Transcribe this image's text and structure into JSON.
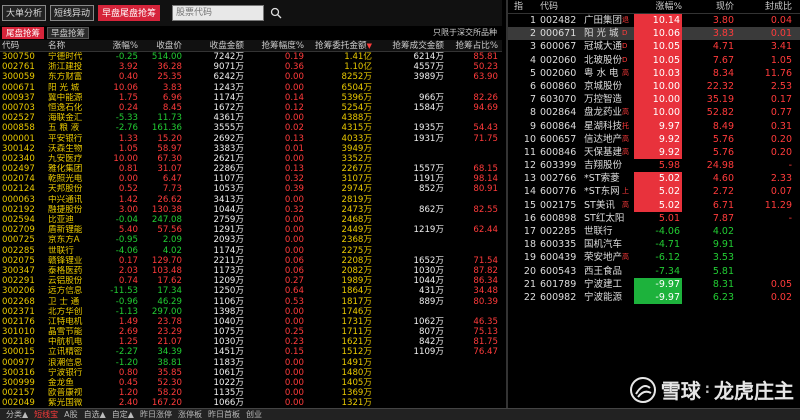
{
  "topbar": {
    "buttons": [
      "大单分析",
      "短线异动",
      "早盘尾盘抢筹"
    ],
    "search_placeholder": "股票代码"
  },
  "subtabs": [
    "尾盘抢筹",
    "早盘抢筹"
  ],
  "only_note": "只限于深交所品种",
  "left_headers": [
    "代码",
    "名称",
    "涨幅%",
    "收盘价",
    "收盘金额",
    "抢筹幅度%",
    "抢筹委托金额",
    "抢筹成交金额",
    "抢筹占比%"
  ],
  "left_rows": [
    [
      "300750",
      "宁德时代",
      "-0.25",
      "514.00",
      "7242万",
      "0.19",
      "1.41亿",
      "6214万",
      "85.81"
    ],
    [
      "002761",
      "浙江建投",
      "3.92",
      "36.28",
      "9071万",
      "0.36",
      "1.10亿",
      "4557万",
      "50.23"
    ],
    [
      "300059",
      "东方财富",
      "0.40",
      "25.35",
      "6242万",
      "0.00",
      "8252万",
      "3989万",
      "63.90"
    ],
    [
      "000671",
      "阳 光 城",
      "10.06",
      "3.83",
      "1243万",
      "0.00",
      "6504万",
      "",
      ""
    ],
    [
      "000937",
      "冀中能源",
      "1.75",
      "6.96",
      "1174万",
      "0.14",
      "5396万",
      "966万",
      "82.26"
    ],
    [
      "000703",
      "恒逸石化",
      "0.24",
      "8.45",
      "1672万",
      "0.12",
      "5254万",
      "1584万",
      "94.69"
    ],
    [
      "002527",
      "海联金汇",
      "-5.33",
      "11.73",
      "4361万",
      "0.00",
      "4388万",
      "",
      ""
    ],
    [
      "000858",
      "五 粮 液",
      "-2.76",
      "161.36",
      "3555万",
      "0.02",
      "4315万",
      "1935万",
      "54.43"
    ],
    [
      "000001",
      "平安银行",
      "1.33",
      "15.20",
      "2692万",
      "0.13",
      "4033万",
      "1931万",
      "71.75"
    ],
    [
      "300142",
      "沃森生物",
      "1.05",
      "58.97",
      "3383万",
      "0.01",
      "3949万",
      "",
      ""
    ],
    [
      "002340",
      "九安医疗",
      "10.00",
      "67.30",
      "2621万",
      "0.00",
      "3352万",
      "",
      ""
    ],
    [
      "002497",
      "雅化集团",
      "0.81",
      "31.07",
      "2286万",
      "0.13",
      "2267万",
      "1557万",
      "68.15"
    ],
    [
      "002074",
      "乾照光电",
      "0.00",
      "6.47",
      "1107万",
      "0.32",
      "3107万",
      "1191万",
      "98.14"
    ],
    [
      "002124",
      "天邦股份",
      "0.52",
      "7.73",
      "1053万",
      "0.39",
      "2974万",
      "852万",
      "80.91"
    ],
    [
      "000063",
      "中兴通讯",
      "1.42",
      "26.62",
      "3413万",
      "0.00",
      "2819万",
      "",
      ""
    ],
    [
      "002192",
      "融捷股份",
      "3.00",
      "130.38",
      "1044万",
      "0.32",
      "2473万",
      "862万",
      "82.55"
    ],
    [
      "002594",
      "比亚迪",
      "-0.04",
      "247.08",
      "2759万",
      "0.00",
      "2468万",
      "",
      ""
    ],
    [
      "002709",
      "盾新锂能",
      "5.40",
      "57.56",
      "1291万",
      "0.00",
      "2449万",
      "1219万",
      "62.44"
    ],
    [
      "000725",
      "京东方A",
      "-0.95",
      "2.09",
      "2093万",
      "0.00",
      "2368万",
      "",
      ""
    ],
    [
      "002285",
      "世联行",
      "-4.06",
      "4.02",
      "1174万",
      "0.00",
      "2275万",
      "",
      ""
    ],
    [
      "002075",
      "赣锋锂业",
      "0.17",
      "129.70",
      "2211万",
      "0.06",
      "2208万",
      "1652万",
      "71.54"
    ],
    [
      "300347",
      "泰格医药",
      "2.03",
      "103.48",
      "1173万",
      "0.06",
      "2082万",
      "1030万",
      "87.82"
    ],
    [
      "002291",
      "云铝股份",
      "0.74",
      "17.62",
      "1209万",
      "0.27",
      "1989万",
      "1044万",
      "86.34"
    ],
    [
      "300206",
      "远方信息",
      "-11.53",
      "17.34",
      "1250万",
      "0.64",
      "1864万",
      "431万",
      "34.48"
    ],
    [
      "002268",
      "卫 士 通",
      "-0.96",
      "46.29",
      "1106万",
      "0.53",
      "1817万",
      "889万",
      "80.39"
    ],
    [
      "002371",
      "北方华创",
      "-1.13",
      "297.00",
      "1398万",
      "0.00",
      "1746万",
      "",
      ""
    ],
    [
      "002176",
      "江特电机",
      "1.49",
      "23.78",
      "1040万",
      "0.00",
      "1731万",
      "1062万",
      "46.35"
    ],
    [
      "301010",
      "晶雪节能",
      "2.69",
      "23.29",
      "1075万",
      "0.25",
      "1711万",
      "807万",
      "75.13"
    ],
    [
      "002180",
      "中航机电",
      "1.25",
      "21.07",
      "1030万",
      "0.23",
      "1621万",
      "842万",
      "81.75"
    ],
    [
      "300015",
      "立讯精密",
      "-2.27",
      "34.39",
      "1451万",
      "0.15",
      "1512万",
      "1109万",
      "76.47"
    ],
    [
      "000977",
      "浪潮信息",
      "-1.20",
      "38.81",
      "1183万",
      "0.00",
      "1491万",
      "",
      ""
    ],
    [
      "300316",
      "宁波银行",
      "0.80",
      "35.85",
      "1061万",
      "0.00",
      "1480万",
      "",
      ""
    ],
    [
      "300999",
      "金龙鱼",
      "0.45",
      "52.30",
      "1022万",
      "0.00",
      "1405万",
      "",
      ""
    ],
    [
      "002157",
      "欧普康视",
      "1.20",
      "58.20",
      "1135万",
      "0.00",
      "1369万",
      "",
      ""
    ],
    [
      "002049",
      "紫光国微",
      "2.40",
      "167.20",
      "1066万",
      "0.00",
      "1321万",
      "",
      ""
    ],
    [
      "002812",
      "恩捷股份",
      "1.50",
      "260.88",
      "1311万",
      "0.00",
      "1314万",
      "",
      ""
    ]
  ],
  "right_headers": [
    "指",
    "代码",
    "",
    "涨幅%",
    "现价",
    "封成比"
  ],
  "right_rows": [
    {
      "num": "1",
      "code": "002482",
      "name": "广田集团",
      "mark": "退",
      "chg": "10.14",
      "price": "3.80",
      "seal": "0.04",
      "hl": "red",
      "color": "red",
      "namecolor": "yellow"
    },
    {
      "num": "2",
      "code": "000671",
      "name": "阳 光 城",
      "mark": "D",
      "chg": "10.06",
      "price": "3.83",
      "seal": "0.01",
      "hl": "red",
      "color": "red",
      "namecolor": "yellow"
    },
    {
      "num": "3",
      "code": "600067",
      "name": "冠城大通",
      "mark": "D",
      "chg": "10.05",
      "price": "4.71",
      "seal": "3.41",
      "hl": "red",
      "color": "red",
      "namecolor": "w"
    },
    {
      "num": "4",
      "code": "002060",
      "name": "北玻股份",
      "mark": "D",
      "chg": "10.05",
      "price": "7.67",
      "seal": "1.05",
      "hl": "red",
      "color": "red",
      "namecolor": "yellow"
    },
    {
      "num": "5",
      "code": "002060",
      "name": "粤 水 电",
      "mark": "高",
      "chg": "10.03",
      "price": "8.34",
      "seal": "11.76",
      "hl": "red",
      "color": "red",
      "namecolor": "yellow"
    },
    {
      "num": "6",
      "code": "600860",
      "name": "京城股份",
      "mark": "",
      "chg": "10.00",
      "price": "22.32",
      "seal": "2.53",
      "hl": "red",
      "color": "red",
      "namecolor": "w"
    },
    {
      "num": "7",
      "code": "603070",
      "name": "万控智造",
      "mark": "",
      "chg": "10.00",
      "price": "35.19",
      "seal": "0.17",
      "hl": "red",
      "color": "red",
      "namecolor": "w"
    },
    {
      "num": "8",
      "code": "002864",
      "name": "盘龙药业",
      "mark": "高",
      "chg": "10.00",
      "price": "52.82",
      "seal": "0.77",
      "hl": "red",
      "color": "red",
      "namecolor": "yellow"
    },
    {
      "num": "9",
      "code": "600864",
      "name": "星湖科技",
      "mark": "托",
      "chg": "9.97",
      "price": "8.49",
      "seal": "0.31",
      "hl": "red",
      "color": "red",
      "namecolor": "w"
    },
    {
      "num": "10",
      "code": "600657",
      "name": "信达地产",
      "mark": "高",
      "chg": "9.92",
      "price": "5.76",
      "seal": "0.20",
      "hl": "red",
      "color": "red",
      "namecolor": "w"
    },
    {
      "num": "11",
      "code": "600846",
      "name": "天保基建",
      "mark": "高",
      "chg": "9.92",
      "price": "5.76",
      "seal": "0.20",
      "hl": "red",
      "color": "red",
      "namecolor": "yellow"
    },
    {
      "num": "12",
      "code": "603399",
      "name": "吉翔股份",
      "mark": "",
      "chg": "5.98",
      "price": "24.98",
      "seal": "-",
      "hl": "",
      "color": "red",
      "namecolor": "w"
    },
    {
      "num": "13",
      "code": "002766",
      "name": "*ST索菱",
      "mark": "",
      "chg": "5.02",
      "price": "4.60",
      "seal": "2.33",
      "hl": "red",
      "color": "red",
      "namecolor": "w"
    },
    {
      "num": "14",
      "code": "600776",
      "name": "*ST东网",
      "mark": "上",
      "chg": "5.02",
      "price": "2.72",
      "seal": "0.07",
      "hl": "red",
      "color": "red",
      "namecolor": "w"
    },
    {
      "num": "15",
      "code": "002175",
      "name": "ST美讯",
      "mark": "高",
      "chg": "5.02",
      "price": "6.71",
      "seal": "11.29",
      "hl": "red",
      "color": "red",
      "namecolor": "w"
    },
    {
      "num": "16",
      "code": "600898",
      "name": "ST红太阳",
      "mark": "",
      "chg": "5.01",
      "price": "7.87",
      "seal": "-",
      "hl": "",
      "color": "red",
      "namecolor": "w"
    },
    {
      "num": "17",
      "code": "002285",
      "name": "世联行",
      "mark": "",
      "chg": "-4.06",
      "price": "4.02",
      "seal": "",
      "hl": "",
      "color": "green",
      "namecolor": "w"
    },
    {
      "num": "18",
      "code": "600335",
      "name": "国机汽车",
      "mark": "",
      "chg": "-4.71",
      "price": "9.91",
      "seal": "",
      "hl": "",
      "color": "green",
      "namecolor": "yellow"
    },
    {
      "num": "19",
      "code": "600439",
      "name": "荣安地产",
      "mark": "高",
      "chg": "-6.12",
      "price": "3.53",
      "seal": "",
      "hl": "",
      "color": "green",
      "namecolor": "yellow"
    },
    {
      "num": "20",
      "code": "600543",
      "name": "西王食品",
      "mark": "",
      "chg": "-7.34",
      "price": "5.81",
      "seal": "",
      "hl": "",
      "color": "green",
      "namecolor": "w"
    },
    {
      "num": "21",
      "code": "601789",
      "name": "宁波建工",
      "mark": "",
      "chg": "-9.97",
      "price": "8.31",
      "seal": "0.05",
      "hl": "green",
      "color": "green",
      "namecolor": "yellow"
    },
    {
      "num": "22",
      "code": "600982",
      "name": "宁波能源",
      "mark": "",
      "chg": "-9.97",
      "price": "6.23",
      "seal": "0.02",
      "hl": "green",
      "color": "green",
      "namecolor": "w"
    }
  ],
  "bottombar": [
    "分类▲",
    "短线宝",
    "A股",
    "自选▲",
    "自定▲",
    "昨日涨停",
    "涨停板",
    "昨日首板",
    "创业"
  ],
  "watermark": {
    "brand": "雪球",
    "title": "龙虎庄主"
  }
}
